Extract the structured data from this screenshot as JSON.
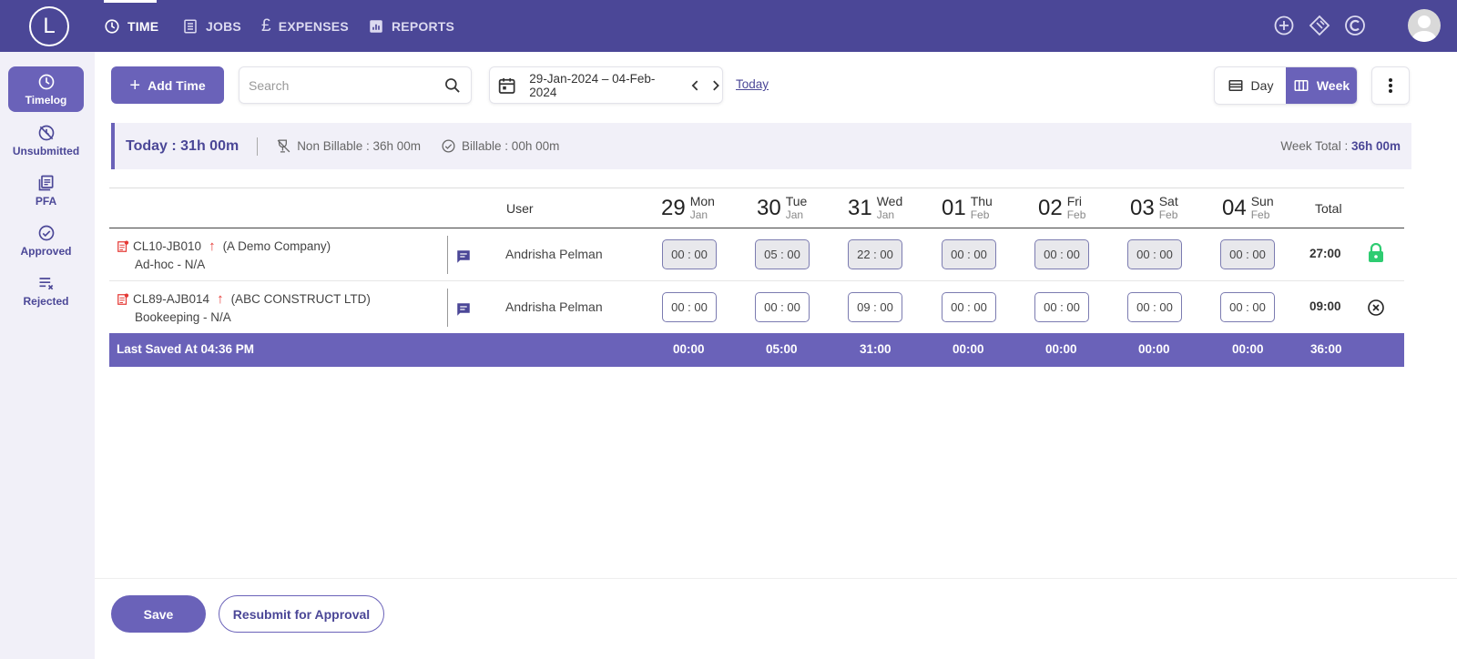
{
  "brand": {
    "logo_letter": "L"
  },
  "nav": [
    {
      "label": "TIME",
      "icon": "clock-icon",
      "active": true
    },
    {
      "label": "JOBS",
      "icon": "list-icon",
      "active": false
    },
    {
      "label": "EXPENSES",
      "icon": "pound-icon",
      "active": false
    },
    {
      "label": "REPORTS",
      "icon": "bar-chart-icon",
      "active": false
    }
  ],
  "top_icons": [
    "add-circle-icon",
    "ticket-icon",
    "c-logo-icon",
    "avatar"
  ],
  "sidebar": [
    {
      "label": "Timelog",
      "icon": "clock-icon",
      "active": true
    },
    {
      "label": "Unsubmitted",
      "icon": "unsubmitted-icon",
      "active": false
    },
    {
      "label": "PFA",
      "icon": "pfa-icon",
      "active": false
    },
    {
      "label": "Approved",
      "icon": "check-circle-icon",
      "active": false
    },
    {
      "label": "Rejected",
      "icon": "rejected-icon",
      "active": false
    }
  ],
  "toolbar": {
    "add_time_label": "Add Time",
    "search_placeholder": "Search",
    "date_range": "29-Jan-2024 – 04-Feb-2024",
    "today_link": "Today",
    "view_day": "Day",
    "view_week": "Week",
    "selected_view": "Week"
  },
  "summary": {
    "today": "Today : 31h 00m",
    "non_billable": "Non Billable : 36h 00m",
    "billable": "Billable : 00h 00m",
    "week_total_label": "Week Total : ",
    "week_total_value": "36h 00m"
  },
  "table": {
    "user_header": "User",
    "total_header": "Total",
    "days": [
      {
        "num": "29",
        "day": "Mon",
        "month": "Jan"
      },
      {
        "num": "30",
        "day": "Tue",
        "month": "Jan"
      },
      {
        "num": "31",
        "day": "Wed",
        "month": "Jan"
      },
      {
        "num": "01",
        "day": "Thu",
        "month": "Feb"
      },
      {
        "num": "02",
        "day": "Fri",
        "month": "Feb"
      },
      {
        "num": "03",
        "day": "Sat",
        "month": "Feb"
      },
      {
        "num": "04",
        "day": "Sun",
        "month": "Feb"
      }
    ],
    "rows": [
      {
        "job_code": "CL10-JB010",
        "client": "(A Demo Company)",
        "task": "Ad-hoc - N/A",
        "user": "Andrisha Pelman",
        "times": [
          "00 : 00",
          "05 : 00",
          "22 : 00",
          "00 : 00",
          "00 : 00",
          "00 : 00",
          "00 : 00"
        ],
        "total": "27:00",
        "status_icon": "lock-icon",
        "locked": true
      },
      {
        "job_code": "CL89-AJB014",
        "client": "(ABC CONSTRUCT LTD)",
        "task": "Bookeeping - N/A",
        "user": "Andrisha Pelman",
        "times": [
          "00 : 00",
          "00 : 00",
          "09 : 00",
          "00 : 00",
          "00 : 00",
          "00 : 00",
          "00 : 00"
        ],
        "total": "09:00",
        "status_icon": "close-circle-icon",
        "locked": false
      }
    ],
    "footer": {
      "label": "Last Saved At 04:36 PM",
      "totals": [
        "00:00",
        "05:00",
        "31:00",
        "00:00",
        "00:00",
        "00:00",
        "00:00"
      ],
      "grand_total": "36:00"
    }
  },
  "actions": {
    "save_label": "Save",
    "resubmit_label": "Resubmit for Approval"
  },
  "colors": {
    "primary": "#4b4797",
    "accent": "#6a62b9",
    "lock_green": "#2ecc71",
    "priority_red": "#e53935"
  }
}
